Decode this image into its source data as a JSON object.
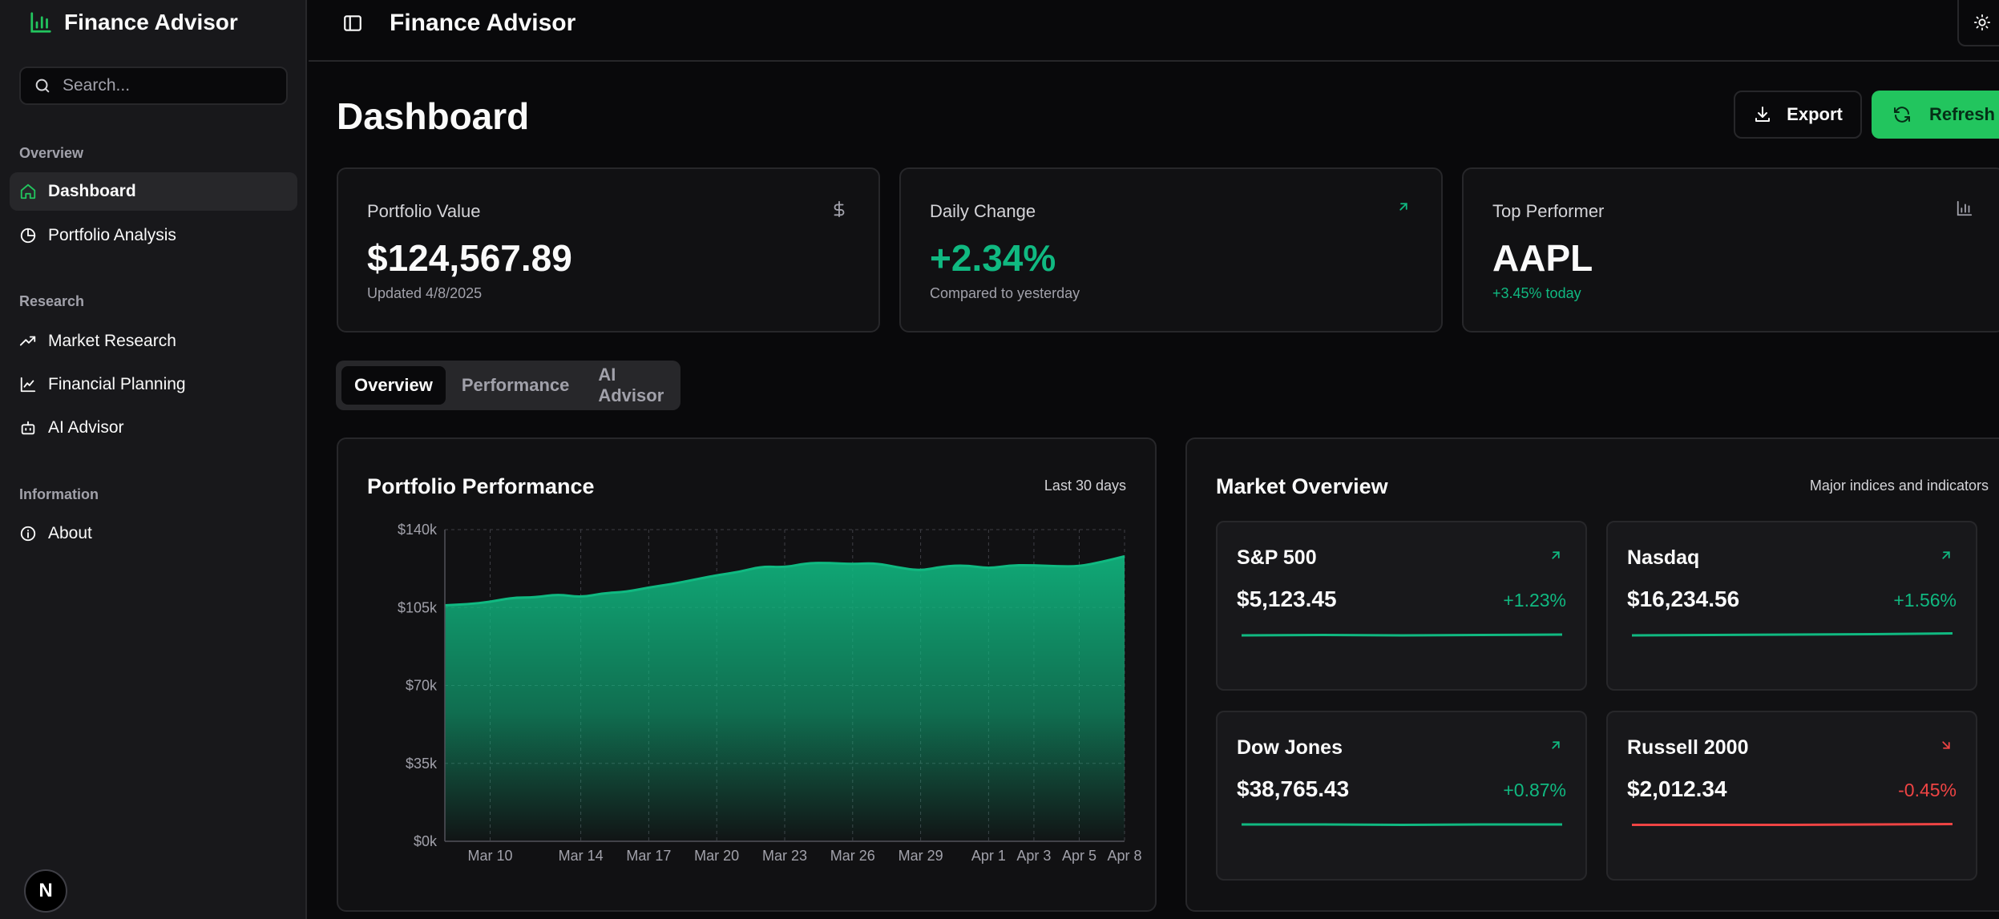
{
  "app": {
    "name": "Finance Advisor"
  },
  "sidebar": {
    "search_placeholder": "Search...",
    "groups": [
      {
        "label": "Overview",
        "items": [
          {
            "label": "Dashboard",
            "active": true
          },
          {
            "label": "Portfolio Analysis"
          }
        ]
      },
      {
        "label": "Research",
        "items": [
          {
            "label": "Market Research"
          },
          {
            "label": "Financial Planning"
          },
          {
            "label": "AI Advisor"
          }
        ]
      },
      {
        "label": "Information",
        "items": [
          {
            "label": "About"
          }
        ]
      }
    ],
    "badge": "N"
  },
  "header": {
    "title": "Finance Advisor"
  },
  "page": {
    "title": "Dashboard",
    "export_label": "Export",
    "refresh_label": "Refresh"
  },
  "stats": [
    {
      "label": "Portfolio Value",
      "value": "$124,567.89",
      "sub": "Updated 4/8/2025",
      "icon": "dollar-icon"
    },
    {
      "label": "Daily Change",
      "value": "+2.34%",
      "sub": "Compared to yesterday",
      "icon": "arrow-up-right-icon"
    },
    {
      "label": "Top Performer",
      "value": "AAPL",
      "sub": "+3.45% today",
      "icon": "bar-chart-icon"
    }
  ],
  "tabs": [
    {
      "label": "Overview",
      "active": true
    },
    {
      "label": "Performance"
    },
    {
      "label": "AI Advisor"
    }
  ],
  "performance_panel": {
    "title": "Portfolio Performance",
    "subtitle": "Last 30 days"
  },
  "market_panel": {
    "title": "Market Overview",
    "subtitle": "Major indices and indicators"
  },
  "markets": [
    {
      "name": "S&P 500",
      "value": "$5,123.45",
      "change": "+1.23%",
      "direction": "up"
    },
    {
      "name": "Nasdaq",
      "value": "$16,234.56",
      "change": "+1.56%",
      "direction": "up"
    },
    {
      "name": "Dow Jones",
      "value": "$38,765.43",
      "change": "+0.87%",
      "direction": "up"
    },
    {
      "name": "Russell 2000",
      "value": "$2,012.34",
      "change": "-0.45%",
      "direction": "down"
    }
  ],
  "colors": {
    "accent": "#22c55e",
    "positive": "#10b981",
    "negative": "#ef4444",
    "background": "#09090b",
    "card": "#111113"
  },
  "chart_data": {
    "type": "area",
    "title": "Portfolio Performance",
    "ylim": [
      0,
      140000
    ],
    "y_ticks": [
      "$0k",
      "$35k",
      "$70k",
      "$105k",
      "$140k"
    ],
    "y_tick_values": [
      0,
      35000,
      70000,
      105000,
      140000
    ],
    "x_tick_labels": [
      "Mar 10",
      "Mar 14",
      "Mar 17",
      "Mar 20",
      "Mar 23",
      "Mar 26",
      "Mar 29",
      "Apr 1",
      "Apr 3",
      "Apr 5",
      "Apr 8"
    ],
    "x_tick_index": [
      2,
      6,
      9,
      12,
      15,
      18,
      21,
      24,
      26,
      28,
      30
    ],
    "values": [
      106000,
      106500,
      107500,
      109500,
      109500,
      111000,
      109500,
      111500,
      112000,
      114000,
      115500,
      117500,
      119500,
      121000,
      123500,
      123000,
      125000,
      125000,
      124500,
      125000,
      123000,
      121500,
      123500,
      124000,
      122500,
      124000,
      124000,
      123500,
      123500,
      125500,
      128000
    ],
    "grid": true
  }
}
